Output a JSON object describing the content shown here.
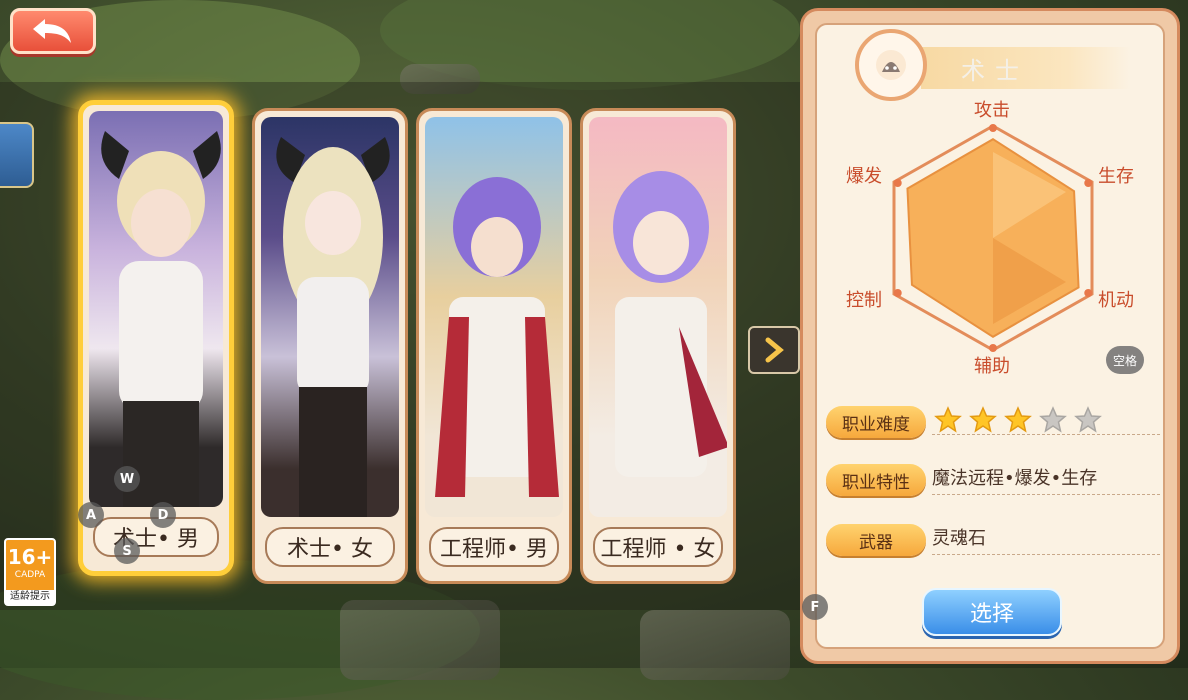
{
  "cards": [
    {
      "label": "术士• 男",
      "selected": true
    },
    {
      "label": "术士• 女",
      "selected": false
    },
    {
      "label": "工程师• 男",
      "selected": false
    },
    {
      "label": "工程师 • 女",
      "selected": false
    }
  ],
  "keys": {
    "w": "W",
    "a": "A",
    "s": "S",
    "d": "D",
    "f": "F",
    "space": "空格"
  },
  "age_rating": {
    "number": "16+",
    "org": "CADPA",
    "hint": "适龄提示"
  },
  "panel": {
    "title": "术士",
    "radar": {
      "labels": [
        "攻击",
        "生存",
        "机动",
        "辅助",
        "控制",
        "爆发"
      ],
      "values": [
        0.95,
        0.9,
        0.95,
        0.95,
        0.9,
        0.95
      ]
    },
    "difficulty_label": "职业难度",
    "difficulty_stars": 3,
    "difficulty_max": 5,
    "trait_label": "职业特性",
    "trait_value": "魔法远程•爆发•生存",
    "weapon_label": "武器",
    "weapon_value": "灵魂石",
    "select_label": "选择"
  },
  "colors": {
    "accent": "#f6a83c",
    "radar_fill": "#f7b05a",
    "select": "#3a8ee8",
    "selected_glow": "#ffce3a"
  },
  "icons": {
    "back": "back-arrow-icon",
    "next": "chevron-right-icon",
    "title": "mage-hat-icon",
    "star": "star-icon"
  }
}
